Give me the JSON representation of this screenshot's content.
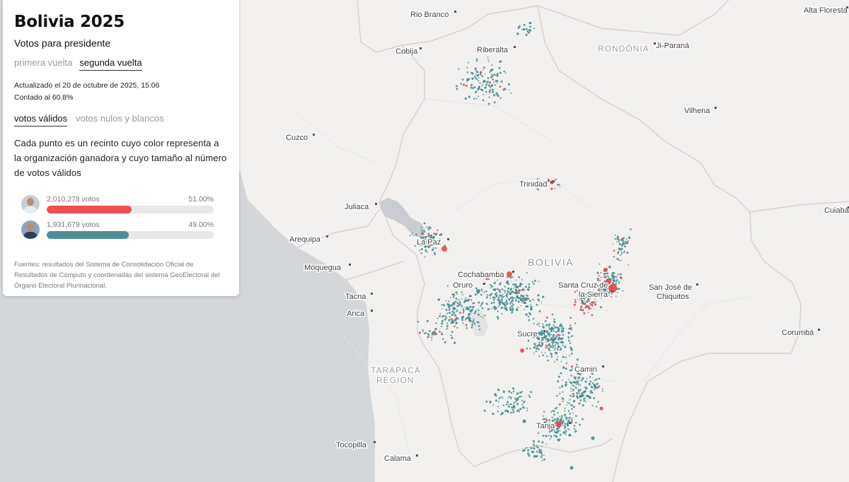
{
  "panel": {
    "title": "Bolivia 2025",
    "subtitle": "Votos para presidente",
    "round_tabs": [
      {
        "label": "primera vuelta",
        "active": false
      },
      {
        "label": "segunda vuelta",
        "active": true
      }
    ],
    "updated": "Actualizado el 20 de octubre de 2025, 15:06",
    "counted": "Contado al 60.8%",
    "vote_tabs": [
      {
        "label": "votos válidos",
        "active": true
      },
      {
        "label": "votos nulos y blancos",
        "active": false
      }
    ],
    "description": "Cada punto es un recinto cuyo color representa a la organización ganadora y cuyo tamaño al número de votos válidos",
    "candidates": [
      {
        "votes": "2,010,278 votos",
        "pct": "51.00%",
        "share": 0.51,
        "color": "#f05050"
      },
      {
        "votes": "1,931,679 votos",
        "pct": "49.00%",
        "share": 0.49,
        "color": "#4a8f95"
      }
    ],
    "sources": "Fuentes: resultados del Sistema de Consolidación Oficial de Resultados de Cómputo y coordenadas del sistema GeoElectoral del Órgano Electoral Plurinacional."
  },
  "map": {
    "country_label": "BOLIVIA",
    "region_labels": [
      "RONDÔNIA",
      "TARAPACÁ",
      "REGION"
    ],
    "cities": [
      "Rio Branco",
      "Alta Floresta",
      "Cobija",
      "Riberalta",
      "Ji-Paraná",
      "Vilhena",
      "Cuzco",
      "Trinidad",
      "Juliaca",
      "Cuiabá",
      "La Paz",
      "Arequipa",
      "Moquegua",
      "Cochabamba",
      "Oruro",
      "Santa Cruz de",
      "la Sierra",
      "San José de",
      "Chiquitos",
      "Tacna",
      "Arica",
      "Sucre",
      "Corumbá",
      "Camiri",
      "Tarija",
      "Tocopilla",
      "Calama"
    ],
    "colors": {
      "winner_a": "#e84848",
      "winner_b": "#3f8a90",
      "land": "#f2f1ef",
      "ocean": "#d4d7da",
      "lake": "#c9cdd1",
      "border": "#d9c7cc"
    }
  }
}
